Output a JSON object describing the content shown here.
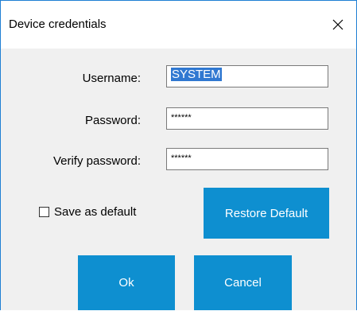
{
  "window": {
    "title": "Device credentials",
    "close_icon": "close-icon"
  },
  "form": {
    "username_label": "Username:",
    "username_value": "SYSTEM",
    "password_label": "Password:",
    "password_value": "******",
    "verify_label": "Verify password:",
    "verify_value": "******"
  },
  "options": {
    "save_default_label": "Save as default",
    "save_default_checked": false
  },
  "buttons": {
    "restore_label": "Restore Default",
    "ok_label": "Ok",
    "cancel_label": "Cancel"
  },
  "colors": {
    "accent": "#0e8fd0",
    "border_accent": "#1f7fd4",
    "selection": "#3078d1"
  }
}
